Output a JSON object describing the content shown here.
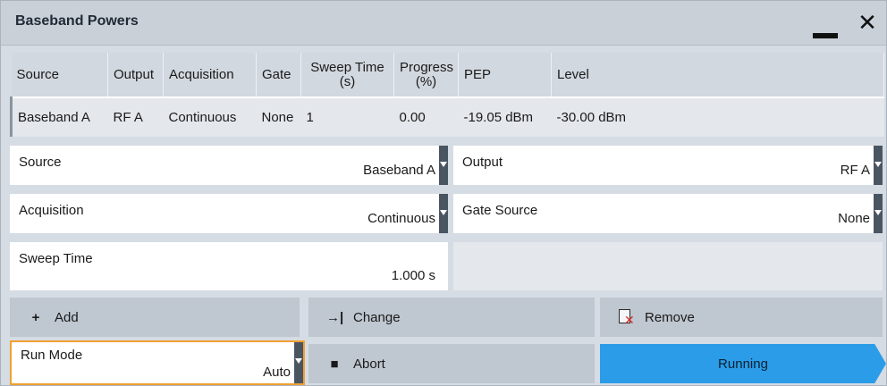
{
  "window": {
    "title": "Baseband Powers",
    "minimize_icon": "minimize-icon",
    "close_label": "✕"
  },
  "table": {
    "headers": {
      "source": "Source",
      "output": "Output",
      "acquisition": "Acquisition",
      "gate": "Gate",
      "sweep_time_line1": "Sweep Time",
      "sweep_time_line2": "(s)",
      "progress_line1": "Progress",
      "progress_line2": "(%)",
      "pep": "PEP",
      "level": "Level"
    },
    "rows": [
      {
        "source": "Baseband A",
        "output": "RF A",
        "acquisition": "Continuous",
        "gate": "None",
        "sweep_time": "1",
        "progress": "0.00",
        "pep": "-19.05 dBm",
        "level": "-30.00 dBm"
      }
    ]
  },
  "form": {
    "source": {
      "label": "Source",
      "value": "Baseband A"
    },
    "output": {
      "label": "Output",
      "value": "RF A"
    },
    "acquisition": {
      "label": "Acquisition",
      "value": "Continuous"
    },
    "gate_source": {
      "label": "Gate Source",
      "value": "None"
    },
    "sweep_time": {
      "label": "Sweep Time",
      "value": "1.000 s"
    }
  },
  "buttons": {
    "add": {
      "label": "Add",
      "icon": "plus-icon",
      "glyph": "+"
    },
    "change": {
      "label": "Change",
      "icon": "change-arrow-icon",
      "glyph": "→|"
    },
    "remove": {
      "label": "Remove",
      "icon": "remove-document-icon"
    },
    "abort": {
      "label": "Abort",
      "icon": "stop-square-icon",
      "glyph": "■"
    },
    "running": {
      "label": "Running"
    }
  },
  "run_mode": {
    "label": "Run Mode",
    "value": "Auto"
  },
  "colors": {
    "accent_running": "#2b9ce8",
    "focus_border": "#f0a030",
    "remove_x": "#d42b2b"
  }
}
